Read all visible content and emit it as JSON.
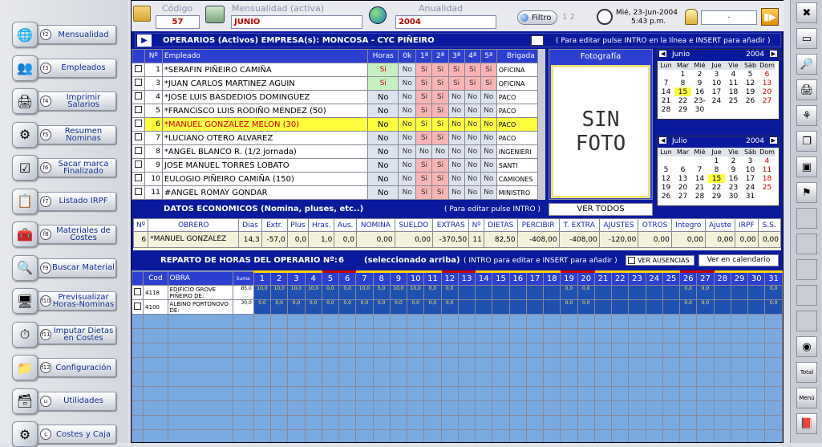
{
  "sidebar": [
    {
      "key": "f2",
      "label": "Mensualidad",
      "icon": "globe-icon",
      "glyph": "🌐"
    },
    {
      "key": "f3",
      "label": "Empleados",
      "icon": "people-icon",
      "glyph": "👥"
    },
    {
      "key": "f4",
      "label": "Imprimir Salarios",
      "icon": "printer-icon",
      "glyph": "🖨"
    },
    {
      "key": "f5",
      "label": "Resumen Nominas",
      "icon": "gear-icon",
      "glyph": "⚙"
    },
    {
      "key": "f6",
      "label": "Sacar marca Finalizado",
      "icon": "checkmark-icon",
      "glyph": "☑"
    },
    {
      "key": "f7",
      "label": "Listado IRPF",
      "icon": "list-icon",
      "glyph": "📋"
    },
    {
      "key": "f8",
      "label": "Materiales de Costes",
      "icon": "tools-icon",
      "glyph": "🧰"
    },
    {
      "key": "f9",
      "label": "Buscar Material",
      "icon": "magnifier-icon",
      "glyph": "🔍"
    },
    {
      "key": "f10",
      "label": "Previsualizar Horas-Nominas",
      "icon": "monitor-icon",
      "glyph": "🖥"
    },
    {
      "key": "f11",
      "label": "Imputar Dietas en Costes",
      "icon": "clock-icon",
      "glyph": "⏱"
    },
    {
      "key": "f12",
      "label": "Configuración",
      "icon": "folder-icon",
      "glyph": "📁"
    },
    {
      "key": "u",
      "label": "Utilidades",
      "icon": "toolbox-icon",
      "glyph": "🗃"
    },
    {
      "key": "c",
      "label": "Costes y Caja",
      "icon": "cog-icon",
      "glyph": "⚙"
    }
  ],
  "topbar": {
    "codigo_label": "Código",
    "codigo": "57",
    "mensualidad_label": "Mensualidad (activa)",
    "mensualidad": "JUNIO",
    "anualidad_label": "Anualidad",
    "anualidad": "2004",
    "filtro": "Filtro",
    "pages": "1 2",
    "datetime_date": "Mié, 23-Jun-2004",
    "datetime_time": "5:43 p.m.",
    "search_value": "."
  },
  "operarios": {
    "title": "OPERARIOS (Activos) EMPRESA(s):   MONCOSA - CYC PIÑEIRO",
    "hint": "( Para editar pulse INTRO en la línea e INSERT para añadir )",
    "columns": [
      "Nº",
      "Empleado",
      "Horas",
      "0k",
      "1ª",
      "2ª",
      "3ª",
      "4ª",
      "5ª",
      "Brigada"
    ],
    "rows": [
      {
        "n": "1",
        "name": "*SERAFIN PIÑEIRO CAMIÑA",
        "horas": "Si",
        "v": [
          "No",
          "Si",
          "Si",
          "Si",
          "Si",
          "Si"
        ],
        "brigada": "OFICINA"
      },
      {
        "n": "3",
        "name": "*JUAN CARLOS MARTINEZ AGUIN",
        "horas": "Si",
        "v": [
          "No",
          "Si",
          "Si",
          "Si",
          "Si",
          "Si"
        ],
        "brigada": "OFICINA"
      },
      {
        "n": "4",
        "name": "*JOSE LUIS BASDEDIOS DOMINGUEZ",
        "horas": "No",
        "v": [
          "No",
          "Si",
          "Si",
          "No",
          "No",
          "No"
        ],
        "brigada": "PACO"
      },
      {
        "n": "5",
        "name": "*FRANCISCO LUIS RODIÑO MENDEZ    (50)",
        "horas": "No",
        "v": [
          "No",
          "Si",
          "Si",
          "No",
          "No",
          "No"
        ],
        "brigada": "PACO"
      },
      {
        "n": "6",
        "name": "*MANUEL GONZALEZ MELON    (30)",
        "horas": "No",
        "v": [
          "No",
          "Si",
          "Si",
          "No",
          "No",
          "No"
        ],
        "brigada": "PACO"
      },
      {
        "n": "7",
        "name": "*LUCIANO OTERO ALVAREZ",
        "horas": "No",
        "v": [
          "No",
          "Si",
          "Si",
          "No",
          "No",
          "No"
        ],
        "brigada": "PACO"
      },
      {
        "n": "8",
        "name": "*ANGEL BLANCO R. (1/2 jornada)",
        "horas": "No",
        "v": [
          "No",
          "No",
          "No",
          "No",
          "No",
          "No"
        ],
        "brigada": "INGENIERI"
      },
      {
        "n": "9",
        "name": "JOSE MANUEL TORRES LOBATO",
        "horas": "No",
        "v": [
          "No",
          "Si",
          "Si",
          "No",
          "No",
          "No"
        ],
        "brigada": "SANTI"
      },
      {
        "n": "10",
        "name": "EULOGIO PIÑEIRO CAMIÑA       (150)",
        "horas": "No",
        "v": [
          "No",
          "Si",
          "Si",
          "No",
          "No",
          "No"
        ],
        "brigada": "CAMIONES"
      },
      {
        "n": "11",
        "name": "#ANGEL ROMAY GONDAR",
        "horas": "No",
        "v": [
          "No",
          "Si",
          "Si",
          "No",
          "No",
          "No"
        ],
        "brigada": "MINISTRO"
      }
    ],
    "selected_index": 4
  },
  "photo": {
    "label": "Fotografía",
    "text_line1": "SIN",
    "text_line2": "FOTO",
    "button": "VER TODOS"
  },
  "cal_june": {
    "month": "Junio",
    "year": "2004",
    "days": [
      "Lun",
      "Mar",
      "Mié",
      "Jue",
      "Vie",
      "Sáb",
      "Dom"
    ],
    "weeks": [
      [
        "",
        "1",
        "2",
        "3",
        "4",
        "5",
        "6"
      ],
      [
        "7",
        "8",
        "9",
        "10",
        "11",
        "12",
        "13"
      ],
      [
        "14",
        "15",
        "16",
        "17",
        "18",
        "19",
        "20"
      ],
      [
        "21",
        "22",
        "23-",
        "24",
        "25",
        "26",
        "27"
      ],
      [
        "28",
        "29",
        "30",
        "",
        "",
        "",
        ""
      ]
    ]
  },
  "cal_july": {
    "month": "Julio",
    "year": "2004",
    "days": [
      "Lun",
      "Mar",
      "Mié",
      "Jue",
      "Vie",
      "Sáb",
      "Dom"
    ],
    "weeks": [
      [
        "",
        "",
        "",
        "1",
        "2",
        "3",
        "4"
      ],
      [
        "5",
        "6",
        "7",
        "8",
        "9",
        "10",
        "11"
      ],
      [
        "12",
        "13",
        "14",
        "15",
        "16",
        "17",
        "18"
      ],
      [
        "19",
        "20",
        "21",
        "22",
        "23",
        "24",
        "25"
      ],
      [
        "26",
        "27",
        "28",
        "29",
        "30",
        "31",
        ""
      ]
    ]
  },
  "economicos": {
    "title": "DATOS ECONOMICOS (Nomina, pluses, etc..)",
    "hint": "( Para editar pulse INTRO )",
    "columns": [
      "Nº",
      "OBRERO",
      "Dias",
      "Extr.",
      "Plus",
      "Hras.",
      "Aus.",
      "NOMINA",
      "SUELDO",
      "EXTRAS",
      "Nº",
      "DIETAS",
      "PERCIBIR",
      "T. EXTRA",
      "AJUSTES",
      "OTROS",
      "Integro",
      "Ajuste",
      "IRPF",
      "S.S."
    ],
    "row": [
      "6",
      "*MANUEL GONZALEZ",
      "14,3",
      "-57,0",
      "0,0",
      "1,0",
      "0,0",
      "0,00",
      "0,00",
      "-370,50",
      "11",
      "82,50",
      "-408,00",
      "-408,00",
      "-120,00",
      "0,00",
      "0,00",
      "0,00",
      "0,00",
      "0,00"
    ]
  },
  "reparto": {
    "title": "REPARTO DE HORAS DEL OPERARIO Nº:",
    "operario": "6",
    "subtitle": "(seleccionado arriba)",
    "hint": "( INTRO para editar e INSERT para añadir )",
    "ausencias": "VER AUSENCIAS",
    "calendario": "Ver en calendario",
    "col_cod": "Cod",
    "col_obra": "OBRA",
    "col_suma": "Suma",
    "rows": [
      {
        "cod": "4118",
        "obra": "EDIFICIO GROVE PIÑEIRO DE:",
        "suma": "85,0",
        "days": [
          "10,0",
          "10,0",
          "10,0",
          "10,0",
          "0,0",
          "0,0",
          "10,0",
          "5,0",
          "10,0",
          "10,0",
          "0,0",
          "0,0",
          "",
          "",
          "",
          "",
          "",
          "",
          "0,0",
          "0,0",
          "",
          "",
          "",
          "",
          "",
          "0,0",
          "0,0",
          "",
          "",
          "",
          "0,0"
        ]
      },
      {
        "cod": "4100",
        "obra": "ALBINO PORTONOVO DE:",
        "suma": "30,0",
        "days": [
          "0,0",
          "0,0",
          "0,0",
          "0,0",
          "0,0",
          "0,0",
          "0,0",
          "0,0",
          "0,0",
          "0,0",
          "0,0",
          "0,0",
          "",
          "",
          "",
          "",
          "",
          "",
          "0,0",
          "0,0",
          "",
          "",
          "",
          "",
          "",
          "0,0",
          "0,0",
          "",
          "",
          "",
          "0,0"
        ]
      }
    ],
    "days": [
      "1",
      "2",
      "3",
      "4",
      "5",
      "6",
      "7",
      "8",
      "9",
      "10",
      "11",
      "12",
      "13",
      "14",
      "15",
      "16",
      "17",
      "18",
      "19",
      "20",
      "21",
      "22",
      "23",
      "24",
      "25",
      "26",
      "27",
      "28",
      "29",
      "30",
      "31"
    ],
    "weekend_days": [
      "5",
      "6",
      "12",
      "13",
      "19",
      "20",
      "26",
      "27"
    ]
  },
  "rightbar": [
    "close-icon",
    "window-icon",
    "search-doc-icon",
    "print-icon",
    "tree-icon",
    "copy-icon",
    "cube-icon",
    "network-icon",
    "blank1-icon",
    "blank2-icon",
    "blank3-icon",
    "blank4-icon",
    "blank5-icon",
    "cd-icon",
    "total-icon",
    "menu-icon",
    "book-icon"
  ],
  "rightbar_labels": {
    "total": "Total",
    "menu": "Menú"
  }
}
